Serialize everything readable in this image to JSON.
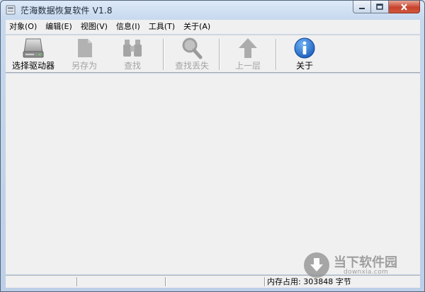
{
  "window": {
    "title": "茫海数据恢复软件 V1.8"
  },
  "menubar": {
    "items": [
      "对象(O)",
      "编辑(E)",
      "视图(V)",
      "信息(I)",
      "工具(T)",
      "关于(A)"
    ]
  },
  "toolbar": {
    "select_drive": "选择驱动器",
    "save_as": "另存为",
    "find": "查找",
    "find_lost": "查找丢失",
    "up_level": "上一层",
    "about": "关于"
  },
  "statusbar": {
    "memory": "内存占用: 303848 字节"
  },
  "watermark": {
    "name": "当下软件园",
    "url": "downxia.com"
  },
  "icons": {
    "select_drive": "hard-drive-icon",
    "save_as": "document-icon",
    "find": "binoculars-icon",
    "find_lost": "magnifier-icon",
    "up_level": "up-arrow-icon",
    "about": "info-icon"
  },
  "colors": {
    "titlebar": "#cfdcee",
    "panel": "#f0f0f0",
    "info_blue": "#1e6fd0",
    "close_red": "#c8432d",
    "disabled_text": "#a3a3a3"
  }
}
